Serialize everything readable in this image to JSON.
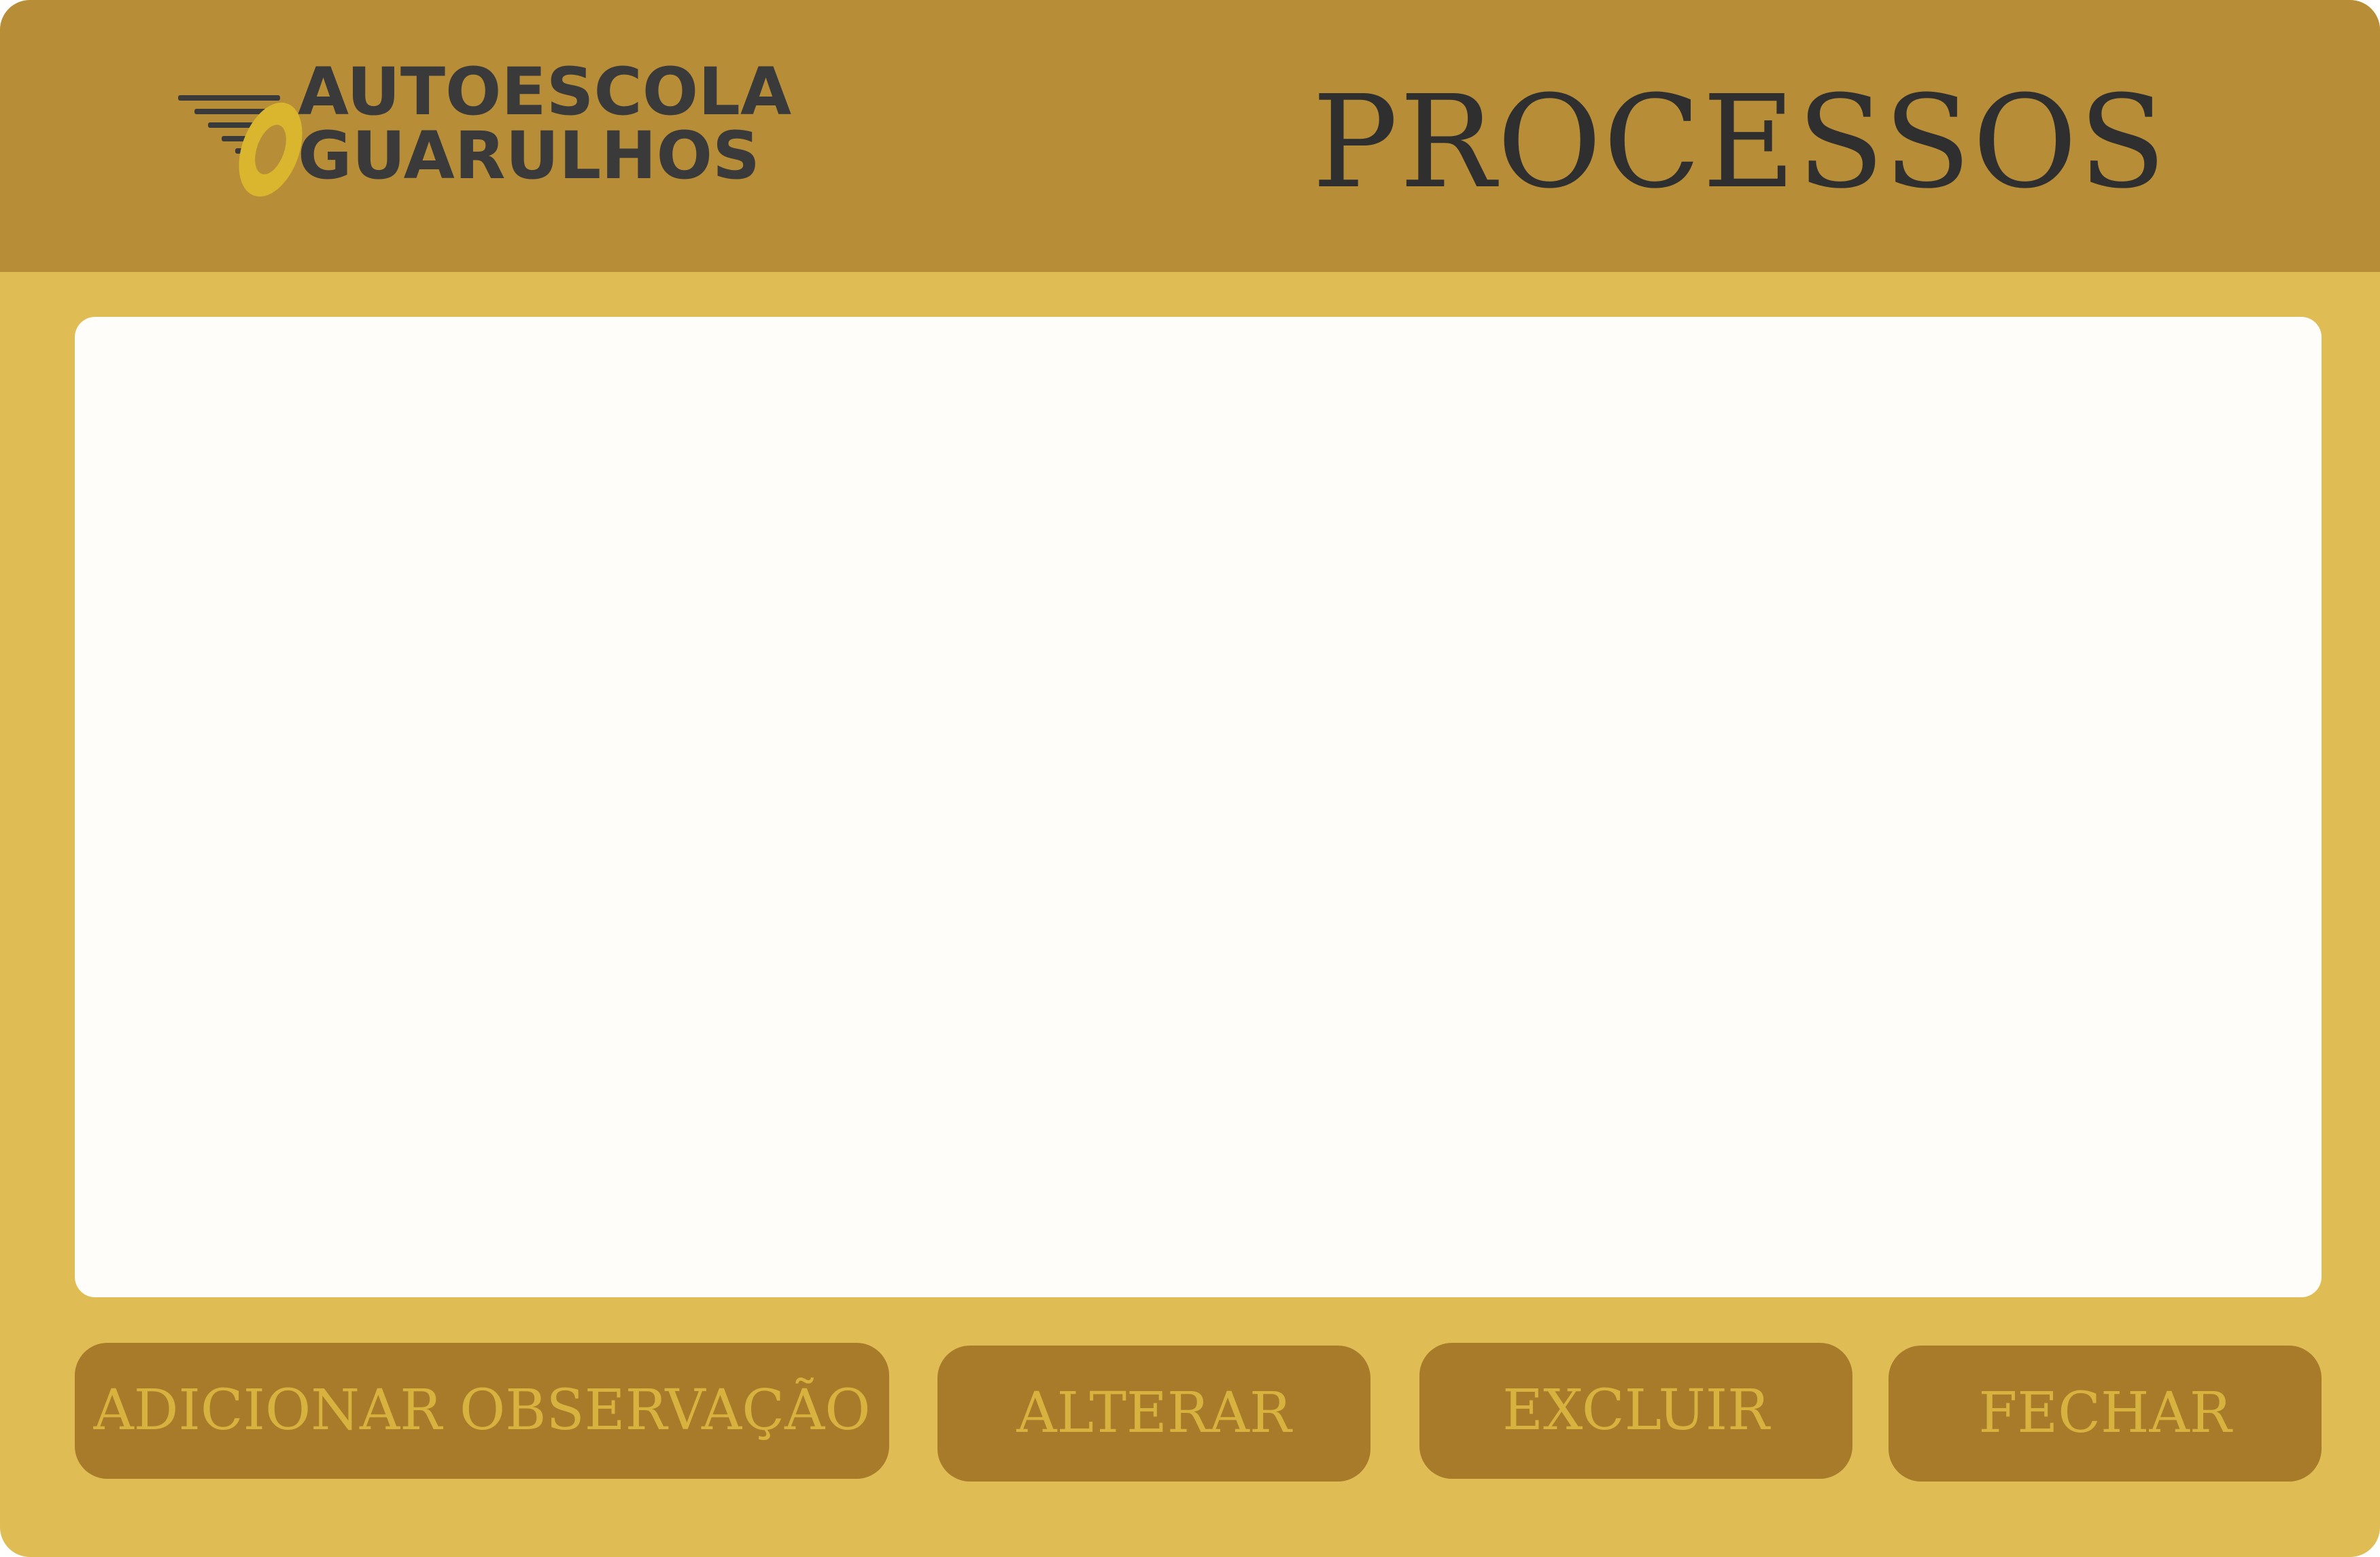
{
  "header": {
    "logo": {
      "line1": "AUTOESCOLA",
      "line2": "GUARULHOS",
      "icon": "steering-wheel-icon"
    },
    "title": "PROCESSOS"
  },
  "actions": {
    "add_observation_label": "ADICIONAR OBSERVAÇÃO",
    "alter_label": "ALTERAR",
    "delete_label": "EXCLUIR",
    "close_label": "FECHAR"
  },
  "colors": {
    "header_bg": "#B88D37",
    "window_bg": "#E0BC55",
    "panel_bg": "#FEFDF9",
    "button_bg": "#A87B2A",
    "button_text": "#D8B23E",
    "title_text": "#2F2F2F",
    "logo_ring": "#D9B62E"
  }
}
